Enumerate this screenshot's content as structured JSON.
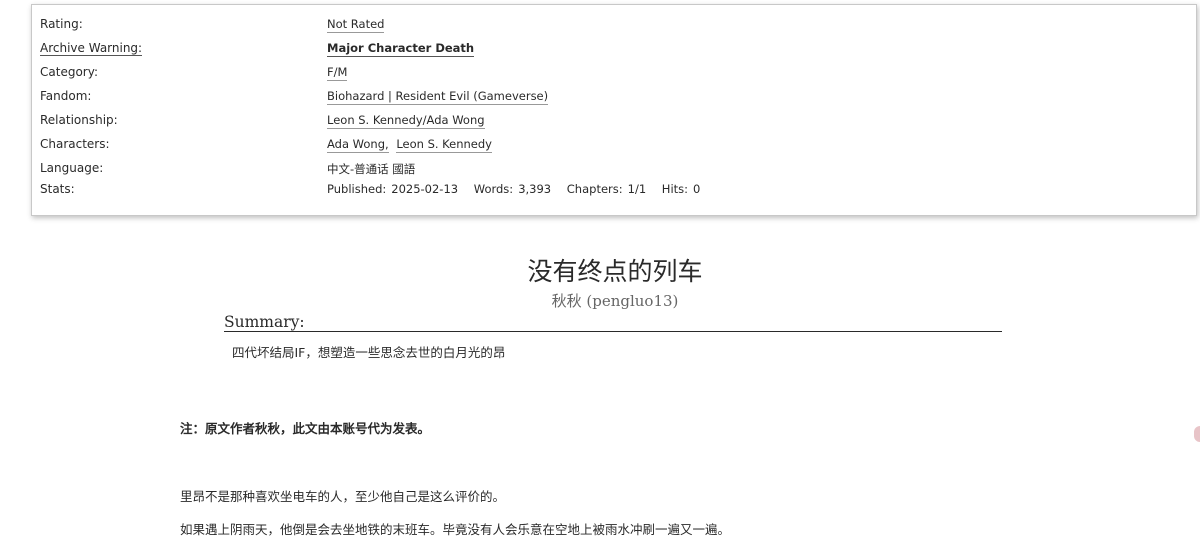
{
  "meta": {
    "rating": {
      "label": "Rating:",
      "value": "Not Rated"
    },
    "warning": {
      "label": "Archive Warning:",
      "value": "Major Character Death"
    },
    "category": {
      "label": "Category:",
      "value": "F/M"
    },
    "fandom": {
      "label": "Fandom:",
      "value": "Biohazard | Resident Evil (Gameverse)"
    },
    "relationship": {
      "label": "Relationship:",
      "value": "Leon S. Kennedy/Ada Wong"
    },
    "characters": {
      "label": "Characters:",
      "values": [
        "Ada Wong,",
        "Leon S. Kennedy"
      ]
    },
    "language": {
      "label": "Language:",
      "value": "中文-普通话 國語"
    },
    "stats": {
      "label": "Stats:",
      "published_label": "Published:",
      "published": "2025-02-13",
      "words_label": "Words:",
      "words": "3,393",
      "chapters_label": "Chapters:",
      "chapters": "1/1",
      "hits_label": "Hits:",
      "hits": "0"
    }
  },
  "work": {
    "title": "没有终点的列车",
    "byline": "秋秋 (pengluo13)"
  },
  "summary": {
    "heading": "Summary:",
    "text": "四代坏结局IF，想塑造一些思念去世的白月光的昂"
  },
  "body": {
    "note": "注：原文作者秋秋，此文由本账号代为发表。",
    "p1": "里昂不是那种喜欢坐电车的人，至少他自己是这么评价的。",
    "p2": "如果遇上阴雨天，他倒是会去坐地铁的末班车。毕竟没有人会乐意在空地上被雨水冲刷一遍又一遍。"
  }
}
